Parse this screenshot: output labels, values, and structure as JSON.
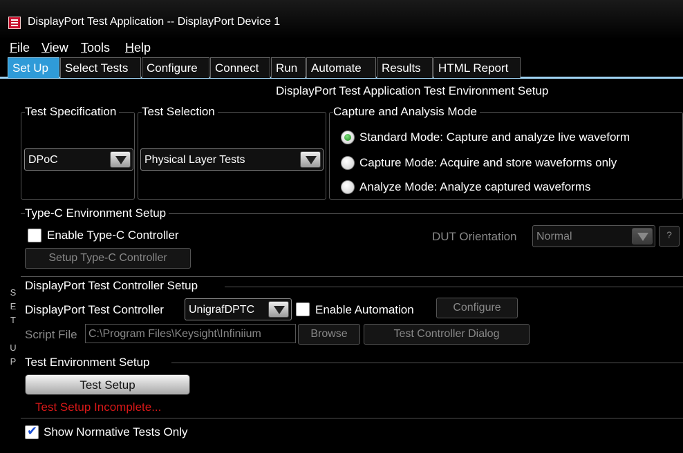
{
  "window": {
    "title": "DisplayPort Test Application -- DisplayPort Device 1",
    "icon": "app-logo-icon"
  },
  "menu": [
    {
      "label": "File",
      "accel": "F",
      "rest": "ile"
    },
    {
      "label": "View",
      "accel": "V",
      "rest": "iew"
    },
    {
      "label": "Tools",
      "accel": "T",
      "rest": "ools"
    },
    {
      "label": "Help",
      "accel": "H",
      "rest": "elp"
    }
  ],
  "tabs": [
    "Set Up",
    "Select Tests",
    "Configure",
    "Connect",
    "Run",
    "Automate",
    "Results",
    "HTML Report"
  ],
  "active_tab": "Set Up",
  "sidetab": {
    "letters": [
      "S",
      "E",
      "T",
      "",
      "U",
      "P"
    ]
  },
  "setup": {
    "heading": "DisplayPort Test Application Test Environment Setup",
    "test_spec": {
      "label": "Test Specification",
      "value": "DPoC"
    },
    "test_selection": {
      "label": "Test Selection",
      "value": "Physical Layer Tests"
    },
    "capture_mode": {
      "label": "Capture and Analysis Mode",
      "options": [
        {
          "label": "Standard Mode: Capture and analyze live waveform",
          "selected": true
        },
        {
          "label": "Capture Mode: Acquire and store waveforms only",
          "selected": false
        },
        {
          "label": "Analyze Mode: Analyze captured waveforms",
          "selected": false
        }
      ]
    },
    "typec": {
      "label": "Type-C Environment Setup",
      "enable_label": "Enable Type-C Controller",
      "enable_checked": false,
      "setup_button": "Setup Type-C Controller",
      "orientation_label": "DUT Orientation",
      "orientation_value": "Normal",
      "help_button": "?"
    },
    "controller": {
      "label": "DisplayPort Test Controller Setup",
      "controller_label": "DisplayPort Test Controller",
      "controller_value": "UnigrafDPTC",
      "automation_label": "Enable Automation",
      "automation_checked": false,
      "configure_button": "Configure",
      "script_label": "Script File",
      "script_value": "C:\\Program Files\\Keysight\\Infiniium",
      "browse_button": "Browse",
      "dialog_button": "Test Controller Dialog"
    },
    "environment": {
      "label": "Test Environment Setup",
      "button": "Test Setup",
      "status": "Test Setup Incomplete...",
      "status_color": "#d81818"
    },
    "normative": {
      "label": "Show Normative Tests Only",
      "checked": true
    }
  },
  "colors": {
    "active_tab": "#2f9bd8",
    "tab_underline": "#9fd3f3",
    "radio_selected": "#1d8a1d"
  }
}
